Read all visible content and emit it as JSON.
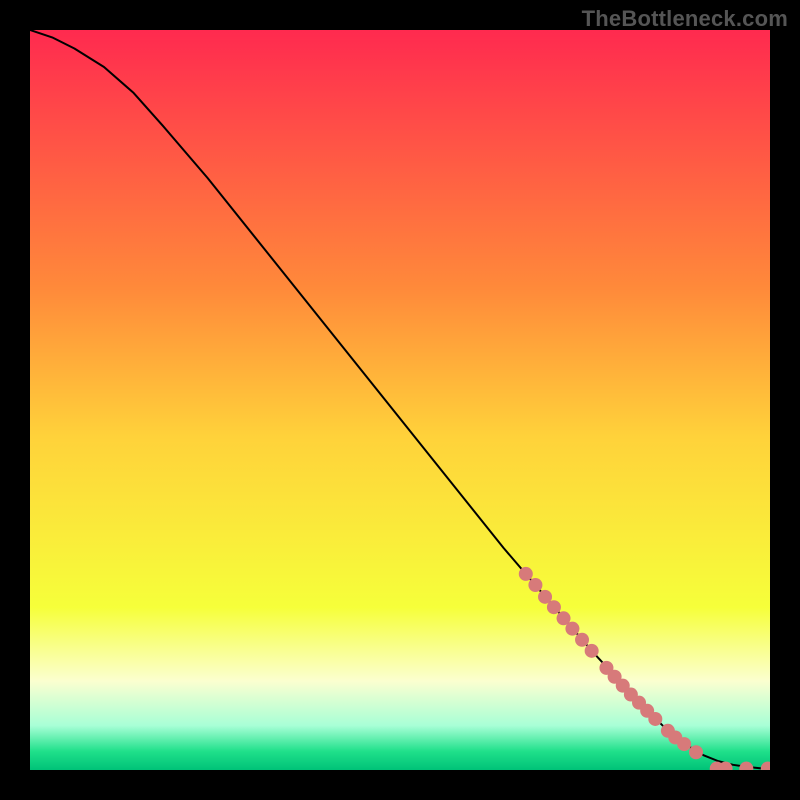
{
  "watermark": "TheBottleneck.com",
  "chart_data": {
    "type": "line",
    "title": "",
    "xlabel": "",
    "ylabel": "",
    "xlim": [
      0,
      100
    ],
    "ylim": [
      0,
      100
    ],
    "grid": false,
    "legend": false,
    "background_gradient_stops": [
      {
        "offset": 0.0,
        "color": "#ff2a4f"
      },
      {
        "offset": 0.35,
        "color": "#ff8a3a"
      },
      {
        "offset": 0.55,
        "color": "#ffd23a"
      },
      {
        "offset": 0.78,
        "color": "#f6ff3a"
      },
      {
        "offset": 0.88,
        "color": "#fbffd0"
      },
      {
        "offset": 0.94,
        "color": "#a8ffd6"
      },
      {
        "offset": 0.975,
        "color": "#1fe08a"
      },
      {
        "offset": 1.0,
        "color": "#00c278"
      }
    ],
    "series": [
      {
        "name": "curve",
        "color": "#000000",
        "stroke_width": 2,
        "x": [
          0,
          3,
          6,
          10,
          14,
          18,
          24,
          32,
          40,
          48,
          56,
          64,
          70,
          76,
          82,
          86,
          89,
          91,
          93,
          95,
          97,
          99,
          100
        ],
        "y": [
          100,
          99,
          97.5,
          95,
          91.5,
          87,
          80,
          70,
          60,
          50,
          40,
          30,
          23,
          16,
          9.5,
          5.5,
          3.2,
          2.0,
          1.2,
          0.7,
          0.4,
          0.2,
          0.2
        ]
      }
    ],
    "markers": {
      "name": "dots",
      "color": "#d77a7a",
      "radius": 7,
      "points": [
        {
          "x": 67.0,
          "y": 26.5
        },
        {
          "x": 68.3,
          "y": 25.0
        },
        {
          "x": 69.6,
          "y": 23.4
        },
        {
          "x": 70.8,
          "y": 22.0
        },
        {
          "x": 72.1,
          "y": 20.5
        },
        {
          "x": 73.3,
          "y": 19.1
        },
        {
          "x": 74.6,
          "y": 17.6
        },
        {
          "x": 75.9,
          "y": 16.1
        },
        {
          "x": 77.9,
          "y": 13.8
        },
        {
          "x": 79.0,
          "y": 12.6
        },
        {
          "x": 80.1,
          "y": 11.4
        },
        {
          "x": 81.2,
          "y": 10.2
        },
        {
          "x": 82.3,
          "y": 9.1
        },
        {
          "x": 83.4,
          "y": 8.0
        },
        {
          "x": 84.5,
          "y": 6.9
        },
        {
          "x": 86.2,
          "y": 5.3
        },
        {
          "x": 87.2,
          "y": 4.4
        },
        {
          "x": 88.4,
          "y": 3.5
        },
        {
          "x": 90.0,
          "y": 2.4
        },
        {
          "x": 92.8,
          "y": 0.2
        },
        {
          "x": 94.0,
          "y": 0.2
        },
        {
          "x": 96.8,
          "y": 0.2
        },
        {
          "x": 99.7,
          "y": 0.2
        }
      ]
    }
  }
}
